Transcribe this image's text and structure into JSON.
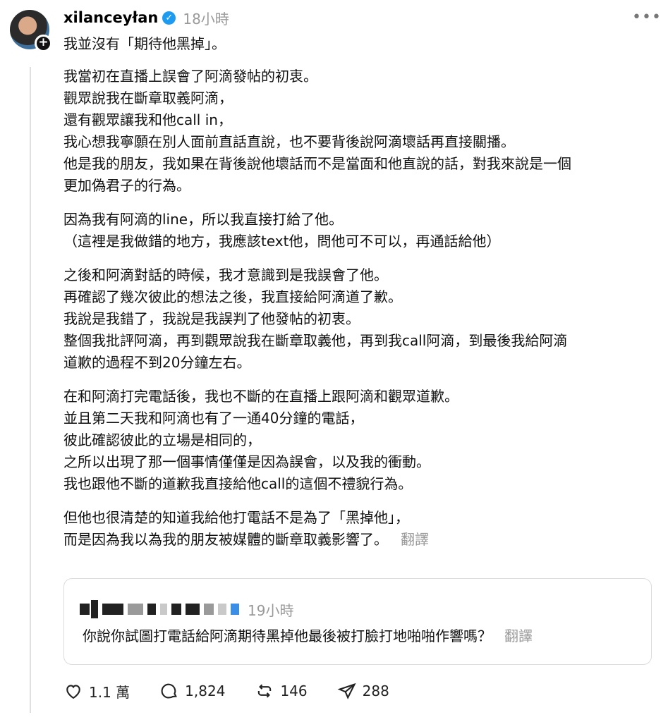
{
  "post": {
    "username": "xilanceyłan",
    "time": "18小時",
    "first_line": "我並沒有「期待他黑掉」。",
    "paragraphs": [
      [
        "我當初在直播上誤會了阿滴發帖的初衷。",
        "觀眾說我在斷章取義阿滴，",
        "還有觀眾讓我和他call in，",
        "我心想我寧願在別人面前直話直說，也不要背後說阿滴壞話再直接關播。",
        "他是我的朋友，我如果在背後說他壞話而不是當面和他直說的話，對我來說是一個",
        "更加偽君子的行為。"
      ],
      [
        "因為我有阿滴的line，所以我直接打給了他。",
        "（這裡是我做錯的地方，我應該text他，問他可不可以，再通話給他）"
      ],
      [
        "之後和阿滴對話的時候，我才意識到是我誤會了他。",
        "再確認了幾次彼此的想法之後，我直接給阿滴道了歉。",
        "我說是我錯了，我說是我誤判了他發帖的初衷。",
        "整個我批評阿滴，再到觀眾說我在斷章取義他，再到我call阿滴，到最後我給阿滴",
        "道歉的過程不到20分鐘左右。"
      ],
      [
        "在和阿滴打完電話後，我也不斷的在直播上跟阿滴和觀眾道歉。",
        "並且第二天我和阿滴也有了一通40分鐘的電話，",
        "彼此確認彼此的立場是相同的，",
        "之所以出現了那一個事情僅僅是因為誤會，以及我的衝動。",
        "我也跟他不斷的道歉我直接給他call的這個不禮貌行為。"
      ]
    ],
    "last_para": [
      "但他也很清楚的知道我給他打電話不是為了「黑掉他」，",
      "而是因為我以為我的朋友被媒體的斷章取義影響了。"
    ],
    "translate_label": "翻譯"
  },
  "quote": {
    "time": "19小時",
    "text": "你說你試圖打電話給阿滴期待黑掉他最後被打臉打地啪啪作響嗎？",
    "translate_label": "翻譯"
  },
  "actions": {
    "likes": "1.1 萬",
    "comments": "1,824",
    "reposts": "146",
    "shares": "288"
  },
  "colors": {
    "verified": "#1d9bf0",
    "muted": "#999999"
  },
  "icons": [
    "more-icon",
    "verified-icon",
    "plus-icon",
    "heart-icon",
    "comment-icon",
    "repost-icon",
    "share-icon"
  ]
}
